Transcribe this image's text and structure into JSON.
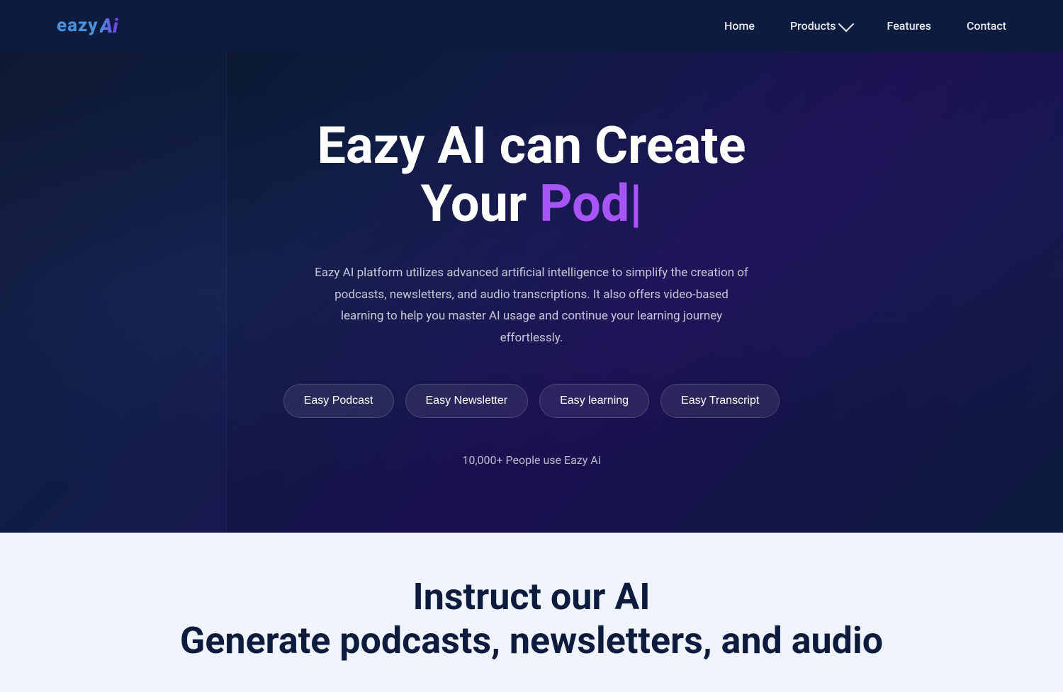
{
  "nav": {
    "logo": {
      "eazy": "eazy",
      "ai": "Ai"
    },
    "links": [
      {
        "id": "home",
        "label": "Home",
        "href": "#"
      },
      {
        "id": "products",
        "label": "Products",
        "href": "#",
        "hasDropdown": true
      },
      {
        "id": "features",
        "label": "Features",
        "href": "#"
      },
      {
        "id": "contact",
        "label": "Contact",
        "href": "#"
      }
    ]
  },
  "hero": {
    "title_line1": "Eazy AI can Create",
    "title_line2_prefix": "Your ",
    "title_line2_highlight": "Pod",
    "title_cursor": "|",
    "description": "Eazy AI platform utilizes advanced artificial intelligence to simplify the creation of podcasts, newsletters, and audio transcriptions. It also offers video-based learning to help you master AI usage and continue your learning journey effortlessly.",
    "products": [
      {
        "id": "podcast",
        "label": "Easy Podcast"
      },
      {
        "id": "newsletter",
        "label": "Easy Newsletter"
      },
      {
        "id": "learning",
        "label": "Easy learning"
      },
      {
        "id": "transcript",
        "label": "Easy Transcript"
      }
    ],
    "users_count": "10,000+ People use Eazy Ai"
  },
  "bottom": {
    "title": "Instruct our AI",
    "subtitle": "Generate podcasts, newsletters, and audio"
  },
  "colors": {
    "accent_purple": "#a855f7",
    "accent_blue": "#4a90d9",
    "nav_bg": "#0d1b3e",
    "hero_bg": "#0d1b3e",
    "bottom_bg": "#f0f4ff",
    "bottom_text": "#0d1b3e"
  }
}
